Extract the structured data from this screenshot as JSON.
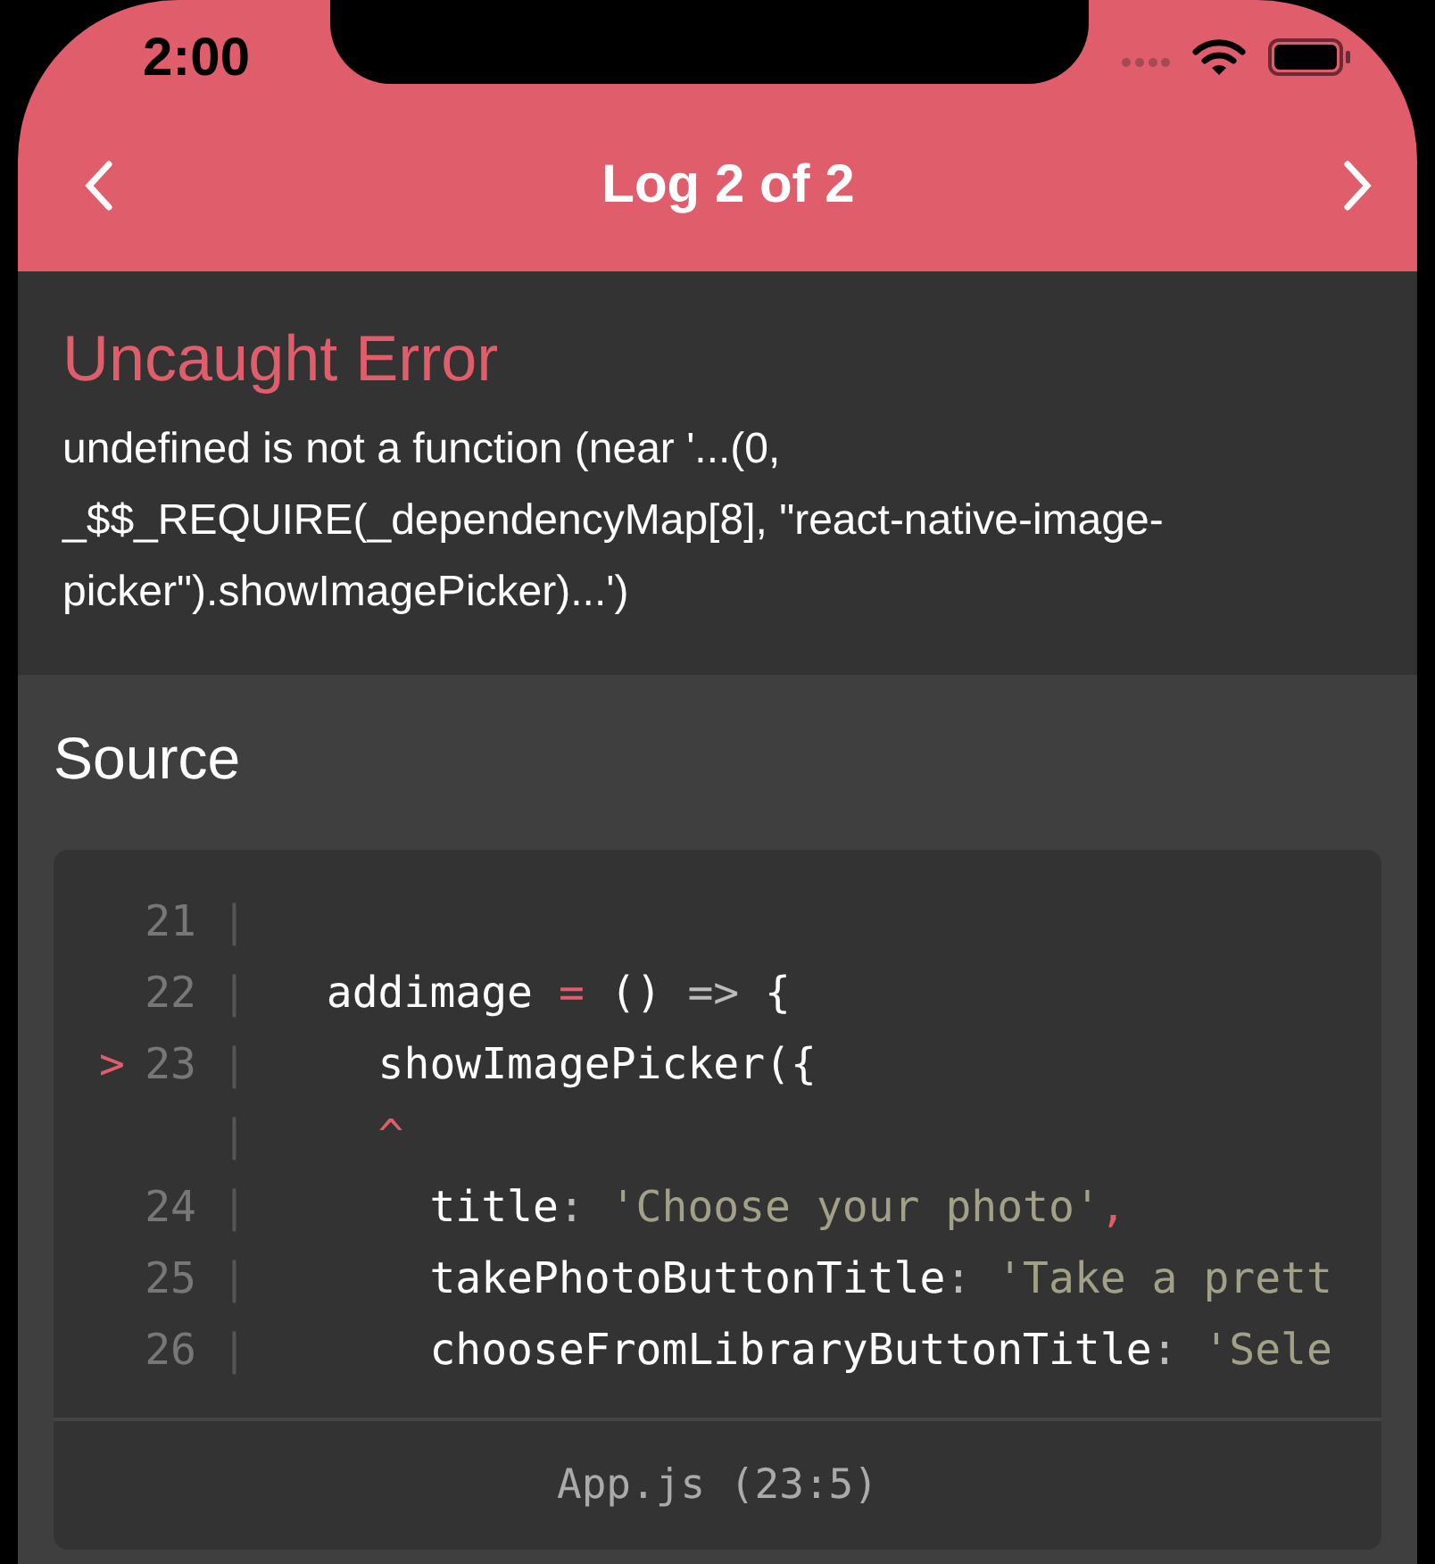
{
  "status_bar": {
    "time": "2:00"
  },
  "header": {
    "title": "Log 2 of 2"
  },
  "error": {
    "title": "Uncaught Error",
    "message": "undefined is not a function (near '...(0, _$$_REQUIRE(_dependencyMap[8], \"react-native-image-picker\").showImagePicker)...')"
  },
  "source": {
    "title": "Source",
    "file": "App.js (23:5)",
    "lines": [
      {
        "kind": "code",
        "number": "21",
        "separator": "|"
      },
      {
        "kind": "code",
        "number": "22",
        "separator": "|",
        "segments": [
          {
            "text": "  addimage ",
            "kind": "plain"
          },
          {
            "text": "=",
            "kind": "operator"
          },
          {
            "text": " () ",
            "kind": "plain"
          },
          {
            "text": "=>",
            "kind": "arrow"
          },
          {
            "text": " {",
            "kind": "plain"
          }
        ]
      },
      {
        "kind": "code",
        "number": "23",
        "separator": "|",
        "marker": ">",
        "segments": [
          {
            "text": "    showImagePicker({",
            "kind": "plain"
          }
        ]
      },
      {
        "kind": "caret",
        "separator": "|",
        "segments": [
          {
            "text": "    ^",
            "kind": "operator"
          }
        ]
      },
      {
        "kind": "code",
        "number": "24",
        "separator": "|",
        "segments": [
          {
            "text": "      title",
            "kind": "plain"
          },
          {
            "text": ": ",
            "kind": "arrow"
          },
          {
            "text": "'Choose your photo'",
            "kind": "string"
          },
          {
            "text": ",",
            "kind": "operator"
          }
        ]
      },
      {
        "kind": "code",
        "number": "25",
        "separator": "|",
        "segments": [
          {
            "text": "      takePhotoButtonTitle",
            "kind": "plain"
          },
          {
            "text": ": ",
            "kind": "arrow"
          },
          {
            "text": "'Take a prett",
            "kind": "string"
          }
        ]
      },
      {
        "kind": "code",
        "number": "26",
        "separator": "|",
        "segments": [
          {
            "text": "      chooseFromLibraryButtonTitle",
            "kind": "plain"
          },
          {
            "text": ": ",
            "kind": "arrow"
          },
          {
            "text": "'Sele",
            "kind": "string"
          }
        ]
      }
    ]
  }
}
